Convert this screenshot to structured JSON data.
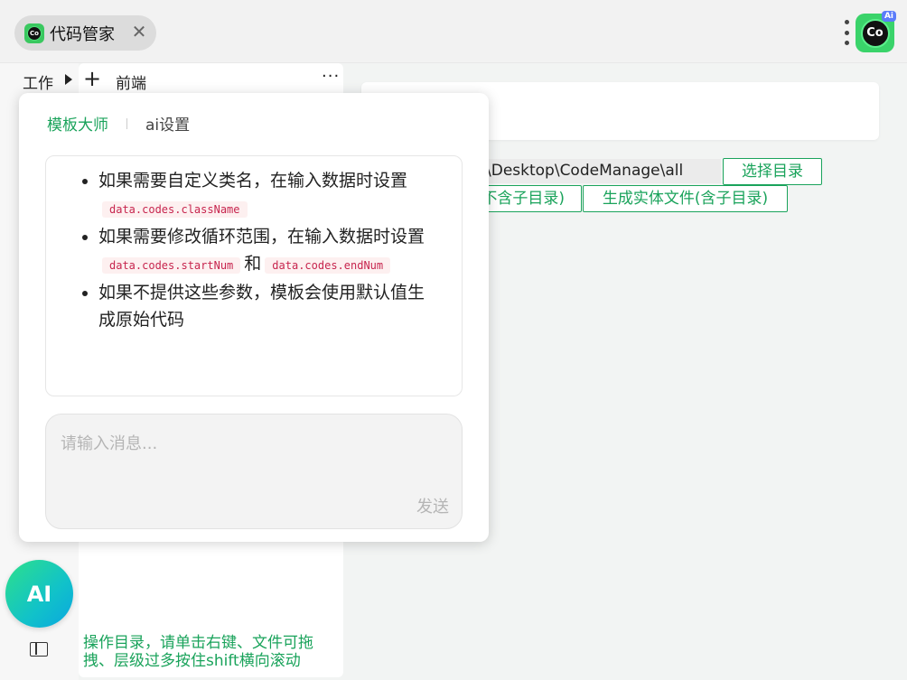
{
  "tab": {
    "title": "代码管家",
    "close": "✕",
    "logo_text": "Co"
  },
  "app_logo": {
    "text": "Co",
    "badge": "Ai"
  },
  "side": {
    "work_label": "工作"
  },
  "tree": {
    "add": "+",
    "group_label": "前端",
    "more": "···"
  },
  "help": {
    "text": "操作目录，请单击右键、文件可拖拽、层级过多按住shift横向滚动"
  },
  "main": {
    "path_value": "\\Desktop\\CodeManage\\all",
    "select_dir": "选择目录",
    "gen_partial": "不含子目录)",
    "gen_full": "生成实体文件(含子目录)"
  },
  "popup": {
    "tab_active": "模板大师",
    "tab_other": "ai设置",
    "items": [
      {
        "text": "如果需要自定义类名，在输入数据时设置",
        "code": "data.codes.className"
      },
      {
        "text1": "如果需要修改循环范围，在输入数据时设置",
        "code1": "data.codes.startNum",
        "and": "和",
        "code2": "data.codes.endNum"
      },
      {
        "text": "如果不提供这些参数，模板会使用默认值生成原始代码"
      }
    ],
    "input_placeholder": "请输入消息...",
    "send": "发送"
  },
  "ai_fab": {
    "label": "AI"
  }
}
